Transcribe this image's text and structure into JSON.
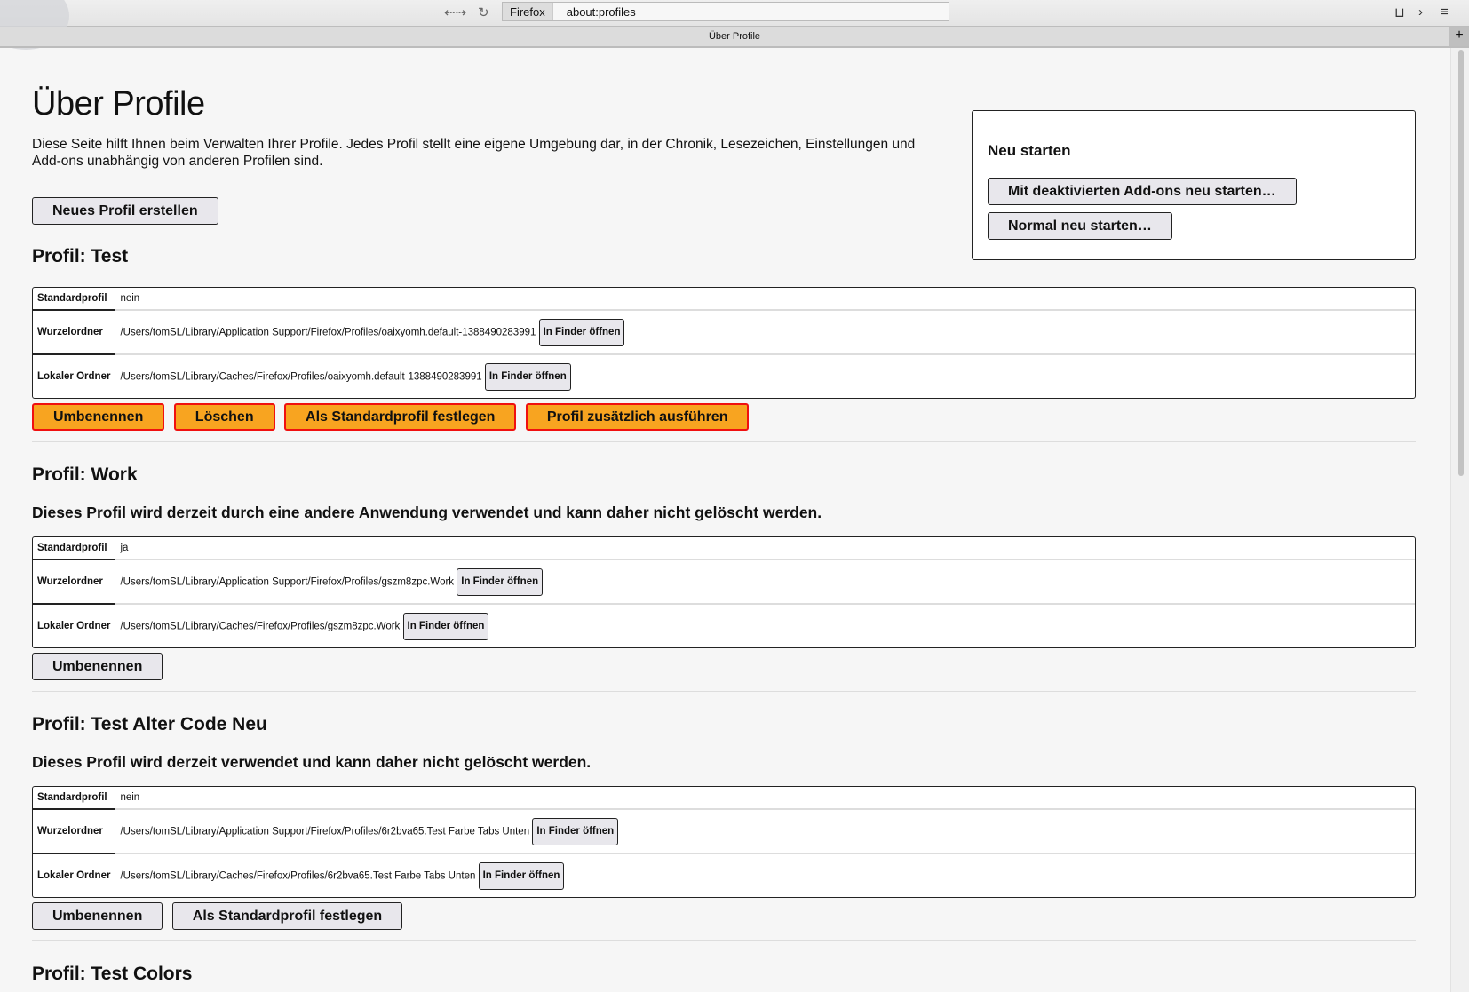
{
  "browser": {
    "identity": "Firefox",
    "url": "about:profiles",
    "tab_title": "Über Profile"
  },
  "page": {
    "title": "Über Profile",
    "description": "Diese Seite hilft Ihnen beim Verwalten Ihrer Profile. Jedes Profil stellt eine eigene Umgebung dar, in der Chronik, Lesezeichen, Einstellungen und Add-ons unabhängig von anderen Profilen sind.",
    "create_button": "Neues Profil erstellen",
    "restart": {
      "title": "Neu starten",
      "safe_mode": "Mit deaktivierten Add-ons neu starten…",
      "normal": "Normal neu starten…"
    },
    "labels": {
      "default": "Standardprofil",
      "root": "Wurzelordner",
      "local": "Lokaler Ordner",
      "open": "In Finder öffnen"
    },
    "profiles": [
      {
        "title": "Profil: Test",
        "default": "nein",
        "root": "/Users/tomSL/Library/Application Support/Firefox/Profiles/oaixyomh.default-1388490283991",
        "local": "/Users/tomSL/Library/Caches/Firefox/Profiles/oaixyomh.default-1388490283991",
        "buttons": [
          "Umbenennen",
          "Löschen",
          "Als Standardprofil festlegen",
          "Profil zusätzlich ausführen"
        ]
      },
      {
        "title": "Profil: Work",
        "warning": "Dieses Profil wird derzeit durch eine andere Anwendung verwendet und kann daher nicht gelöscht werden.",
        "default": "ja",
        "root": "/Users/tomSL/Library/Application Support/Firefox/Profiles/gszm8zpc.Work",
        "local": "/Users/tomSL/Library/Caches/Firefox/Profiles/gszm8zpc.Work",
        "buttons": [
          "Umbenennen"
        ]
      },
      {
        "title": "Profil: Test Alter Code Neu",
        "warning": "Dieses Profil wird derzeit verwendet und kann daher nicht gelöscht werden.",
        "default": "nein",
        "root": "/Users/tomSL/Library/Application Support/Firefox/Profiles/6r2bva65.Test Farbe Tabs Unten",
        "local": "/Users/tomSL/Library/Caches/Firefox/Profiles/6r2bva65.Test Farbe Tabs Unten",
        "buttons": [
          "Umbenennen",
          "Als Standardprofil festlegen"
        ]
      },
      {
        "title": "Profil: Test Colors"
      }
    ]
  }
}
